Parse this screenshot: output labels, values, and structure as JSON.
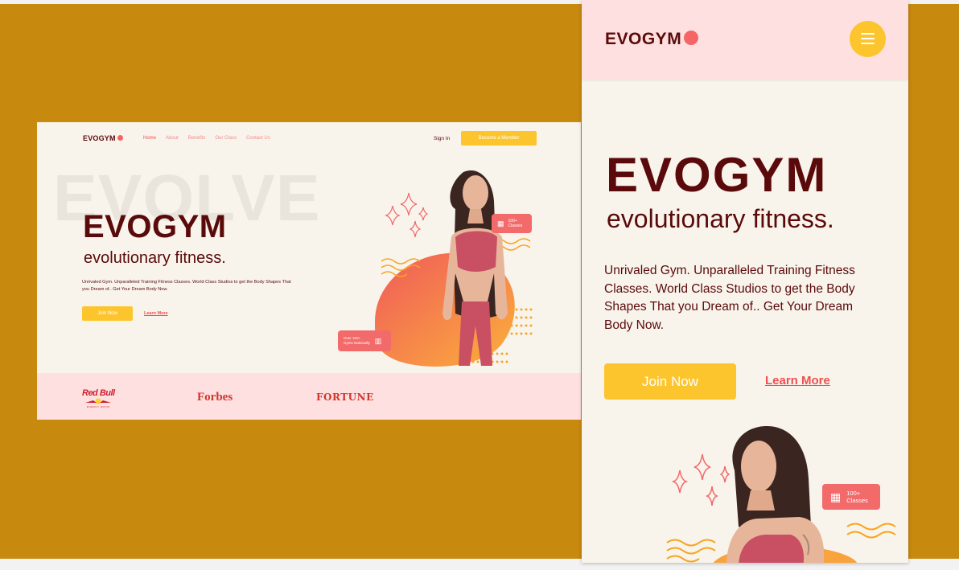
{
  "desktop": {
    "logo": "EVOGYM",
    "nav": [
      "Home",
      "About",
      "Benefits",
      "Our Class",
      "Contact Us"
    ],
    "signin": "Sign In",
    "member_button": "Become a Member",
    "background_word": "EVOLVE",
    "title": "EVOGYM",
    "subtitle": "evolutionary fitness.",
    "paragraph": "Unrivaled Gym. Unparalleled Training Fitness Classes. World Class Studios to get the Body Shapes That you Dream of.. Get Your Dream Body Now.",
    "join_button": "Join Now",
    "learn_more": "Learn More",
    "badge_classes": [
      "100+",
      "Classes"
    ],
    "badge_gyms": [
      "Over 100+",
      "Gyms Nationally"
    ],
    "sponsors": {
      "redbull": "Red Bull",
      "redbull_sub": "ENERGY DRINK",
      "forbes": "Forbes",
      "fortune": "FORTUNE"
    }
  },
  "mobile": {
    "logo": "EVOGYM",
    "title": "EVOGYM",
    "subtitle": "evolutionary fitness.",
    "paragraph": "Unrivaled Gym. Unparalleled Training Fitness Classes. World Class Studios to get the Body Shapes That you Dream of.. Get Your Dream Body Now.",
    "join_button": "Join Now",
    "learn_more": "Learn More",
    "badge_classes": [
      "100+",
      "Classes"
    ]
  },
  "colors": {
    "backdrop": "#c8890f",
    "cream": "#f8f4ec",
    "pink": "#ffe0e0",
    "maroon": "#5a0a0a",
    "yellow": "#fdc52d",
    "coral": "#f26a6a"
  }
}
